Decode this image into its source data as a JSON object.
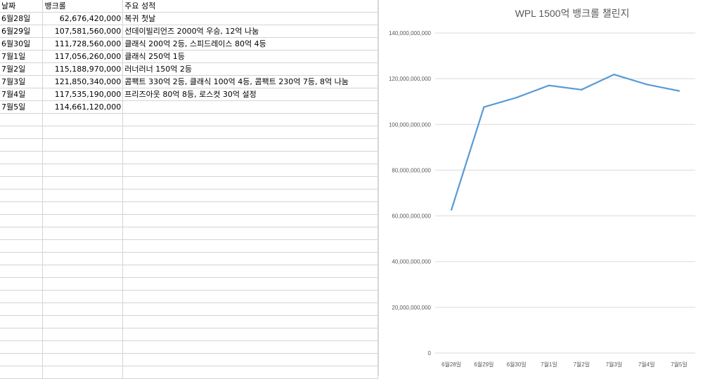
{
  "sheet": {
    "headers": [
      "날짜",
      "뱅크롤",
      "주요 성적"
    ],
    "rows": [
      {
        "date": "6월28일",
        "bankroll": "62,676,420,000",
        "note": "복귀 첫날"
      },
      {
        "date": "6월29일",
        "bankroll": "107,581,560,000",
        "note": "선데이빌리언즈 2000억 우승, 12억 나눔"
      },
      {
        "date": "6월30일",
        "bankroll": "111,728,560,000",
        "note": "클래식 200억 2등, 스피드레이스 80억 4등"
      },
      {
        "date": "7월1일",
        "bankroll": "117,056,260,000",
        "note": "클래식 250억 1등"
      },
      {
        "date": "7월2일",
        "bankroll": "115,188,970,000",
        "note": "러너러너 150억 2등"
      },
      {
        "date": "7월3일",
        "bankroll": "121,850,340,000",
        "note": "콤팩트 330억 2등, 클래식 100억 4등, 콤팩트 230억 7등, 8억 나눔"
      },
      {
        "date": "7월4일",
        "bankroll": "117,535,190,000",
        "note": "프리즈아웃 80억 8등, 로스컷 30억 설정"
      },
      {
        "date": "7월5일",
        "bankroll": "114,661,120,000",
        "note": ""
      }
    ]
  },
  "chart_data": {
    "type": "line",
    "title": "WPL 1500억 뱅크롤 챌린지",
    "categories": [
      "6월28일",
      "6월29일",
      "6월30일",
      "7월1일",
      "7월2일",
      "7월3일",
      "7월4일",
      "7월5일"
    ],
    "series": [
      {
        "values": [
          62676420000,
          107581560000,
          111728560000,
          117056260000,
          115188970000,
          121850340000,
          117535190000,
          114661120000
        ]
      }
    ],
    "ylim": [
      0,
      140000000000
    ],
    "yticks": [
      0,
      20000000000,
      40000000000,
      60000000000,
      80000000000,
      100000000000,
      120000000000,
      140000000000
    ],
    "ytick_labels": [
      "0",
      "20,000,000,000",
      "40,000,000,000",
      "60,000,000,000",
      "80,000,000,000",
      "100,000,000,000",
      "120,000,000,000",
      "140,000,000,000"
    ],
    "grid": true,
    "line_color": "#5b9bd5",
    "grid_color": "#d9d9d9"
  }
}
